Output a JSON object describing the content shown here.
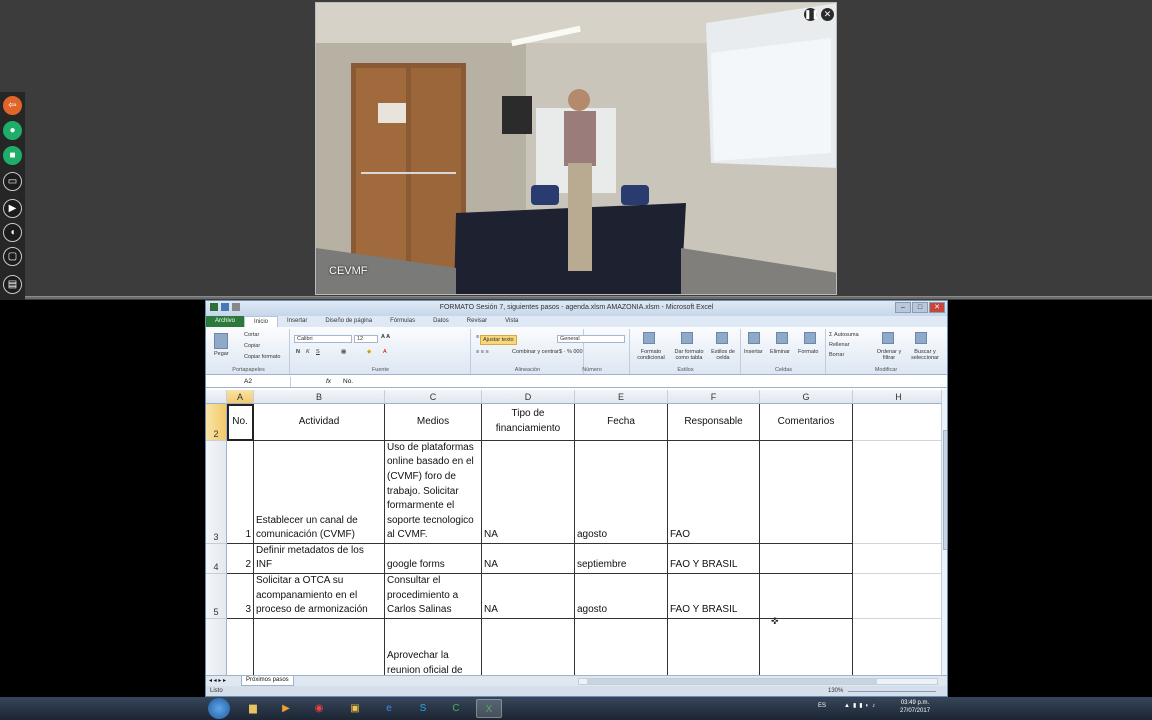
{
  "meeting": {
    "video_label": "CEVMF",
    "pause_icon": "pause-icon",
    "close_icon": "close-icon",
    "side_tools": [
      "share-screen-icon",
      "microphone-icon",
      "camera-icon",
      "monitor-icon",
      "play-icon",
      "mouse-icon",
      "chat-icon",
      "window-icon"
    ]
  },
  "excel": {
    "title": "FORMATO Sesión 7, siguientes pasos - agenda.xlsm AMAZONIA.xlsm - Microsoft Excel",
    "tabs": [
      "Archivo",
      "Inicio",
      "Insertar",
      "Diseño de página",
      "Fórmulas",
      "Datos",
      "Revisar",
      "Vista"
    ],
    "ribbon": {
      "pegar": "Pegar",
      "cortar": "Cortar",
      "copiar": "Copiar",
      "copiar_formato": "Copiar formato",
      "portapapeles": "Portapapeles",
      "font_name": "Calibri",
      "font_size": "12",
      "fuente": "Fuente",
      "ajustar_texto": "Ajustar texto",
      "combinar": "Combinar y centrar",
      "alineacion": "Alineación",
      "number_format": "General",
      "numero": "Número",
      "formato_condicional": "Formato condicional",
      "dar_formato": "Dar formato como tabla",
      "estilos_celda": "Estilos de celda",
      "estilos": "Estilos",
      "insertar": "Insertar",
      "eliminar": "Eliminar",
      "formato": "Formato",
      "celdas": "Celdas",
      "autosuma": "Autosuma",
      "rellenar": "Rellenar",
      "borrar": "Borrar",
      "ordenar": "Ordenar y filtrar",
      "buscar": "Buscar y seleccionar",
      "modificar": "Modificar"
    },
    "name_box": "A2",
    "fx": "fx",
    "formula_value": "No.",
    "columns": [
      "A",
      "B",
      "C",
      "D",
      "E",
      "F",
      "G",
      "H"
    ],
    "rows": [
      {
        "num": "2",
        "cells": [
          "No.",
          "Actividad",
          "Medios",
          "Tipo de financiamiento",
          "Fecha",
          "Responsable",
          "Comentarios",
          ""
        ]
      },
      {
        "num": "3",
        "cells": [
          "1",
          "Establecer un canal de comunicación (CVMF)",
          "Uso de plataformas online basado en el (CVMF) foro de trabajo. Solicitar formarmente el soporte tecnologico al CVMF.",
          "NA",
          "agosto",
          "FAO",
          "",
          ""
        ]
      },
      {
        "num": "4",
        "cells": [
          "2",
          "Definir metadatos de los INF",
          "google forms",
          "NA",
          "septiembre",
          "FAO Y BRASIL",
          "",
          ""
        ]
      },
      {
        "num": "5",
        "cells": [
          "3",
          "Solicitar a OTCA su acompanamiento en el proceso de armonización",
          "Consultar el procedimiento a Carlos Salinas",
          "NA",
          "agosto",
          "FAO Y BRASIL",
          "",
          ""
        ]
      },
      {
        "num": "",
        "cells": [
          "",
          "",
          "Aprovechar la reunion oficial de",
          "",
          "",
          "",
          "",
          ""
        ]
      }
    ],
    "sheet_tab": "Próximos pasos",
    "status": "Listo",
    "zoom": "130%"
  },
  "taskbar": {
    "apps": [
      "explorer-icon",
      "media-player-icon",
      "chrome-icon",
      "folder-icon",
      "ie-icon",
      "skype-icon",
      "camtasia-icon",
      "excel-icon"
    ],
    "lang": "ES",
    "time": "03:49 p.m.",
    "date": "27/07/2017"
  }
}
